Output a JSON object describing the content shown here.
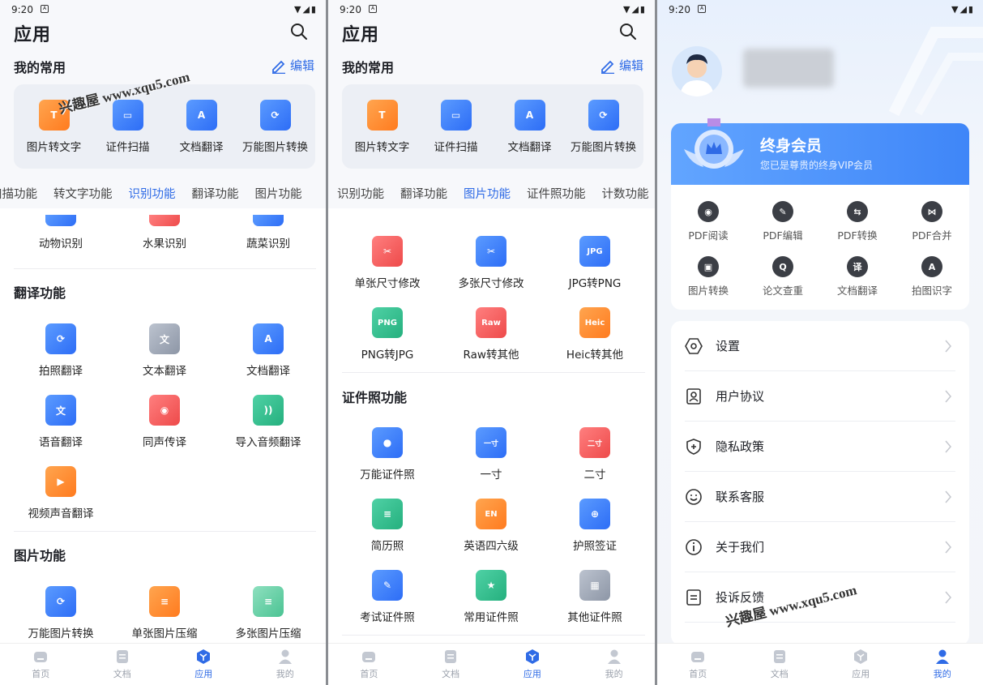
{
  "status": {
    "time": "9:20",
    "icons": "▼◢▮"
  },
  "page_title": "应用",
  "favorites": {
    "title": "我的常用",
    "edit_label": "编辑",
    "items": [
      {
        "label": "图片转文字",
        "icon": "image-to-text-icon",
        "glyph": "T"
      },
      {
        "label": "证件扫描",
        "icon": "id-scan-icon",
        "glyph": "▭"
      },
      {
        "label": "文档翻译",
        "icon": "doc-translate-icon",
        "glyph": "A"
      },
      {
        "label": "万能图片转换",
        "icon": "image-convert-icon",
        "glyph": "⟳"
      }
    ]
  },
  "panel1": {
    "tabs": [
      "扫描功能",
      "转文字功能",
      "识别功能",
      "翻译功能",
      "图片功能"
    ],
    "active_tab": 2,
    "recognize_items": [
      "动物识别",
      "水果识别",
      "蔬菜识别"
    ],
    "translate_title": "翻译功能",
    "translate_items": [
      {
        "label": "拍照翻译",
        "icon": "camera-translate-icon",
        "glyph": "⟳"
      },
      {
        "label": "文本翻译",
        "icon": "text-translate-icon",
        "glyph": "文"
      },
      {
        "label": "文档翻译",
        "icon": "doc-translate-icon",
        "glyph": "A"
      },
      {
        "label": "语音翻译",
        "icon": "voice-translate-icon",
        "glyph": "文"
      },
      {
        "label": "同声传译",
        "icon": "simultaneous-interp-icon",
        "glyph": "◉"
      },
      {
        "label": "导入音频翻译",
        "icon": "audio-import-translate-icon",
        "glyph": "))"
      },
      {
        "label": "视频声音翻译",
        "icon": "video-translate-icon",
        "glyph": "▶"
      }
    ],
    "image_title": "图片功能",
    "image_items": [
      {
        "label": "万能图片转换",
        "icon": "image-convert-icon",
        "glyph": "⟳"
      },
      {
        "label": "单张图片压缩",
        "icon": "image-compress-icon",
        "glyph": "≡"
      },
      {
        "label": "多张图片压缩",
        "icon": "multi-image-compress-icon",
        "glyph": "≡"
      }
    ]
  },
  "panel2": {
    "tabs": [
      "识别功能",
      "翻译功能",
      "图片功能",
      "证件照功能",
      "计数功能"
    ],
    "active_tab": 2,
    "image_items": [
      {
        "label": "单张尺寸修改",
        "icon": "resize-icon",
        "glyph": "✂"
      },
      {
        "label": "多张尺寸修改",
        "icon": "multi-resize-icon",
        "glyph": "✂"
      },
      {
        "label": "JPG转PNG",
        "icon": "jpg-to-png-icon",
        "glyph": "JPG"
      },
      {
        "label": "PNG转JPG",
        "icon": "png-to-jpg-icon",
        "glyph": "PNG"
      },
      {
        "label": "Raw转其他",
        "icon": "raw-convert-icon",
        "glyph": "Raw"
      },
      {
        "label": "Heic转其他",
        "icon": "heic-convert-icon",
        "glyph": "Heic"
      }
    ],
    "idphoto_title": "证件照功能",
    "idphoto_items": [
      {
        "label": "万能证件照",
        "icon": "universal-id-photo-icon",
        "glyph": "●"
      },
      {
        "label": "一寸",
        "icon": "one-inch-photo-icon",
        "glyph": "一寸"
      },
      {
        "label": "二寸",
        "icon": "two-inch-photo-icon",
        "glyph": "二寸"
      },
      {
        "label": "简历照",
        "icon": "resume-photo-icon",
        "glyph": "≡"
      },
      {
        "label": "英语四六级",
        "icon": "cet-photo-icon",
        "glyph": "EN"
      },
      {
        "label": "护照签证",
        "icon": "passport-photo-icon",
        "glyph": "⊕"
      },
      {
        "label": "考试证件照",
        "icon": "exam-photo-icon",
        "glyph": "✎"
      },
      {
        "label": "常用证件照",
        "icon": "common-photo-icon",
        "glyph": "★"
      },
      {
        "label": "其他证件照",
        "icon": "other-photo-icon",
        "glyph": "▦"
      }
    ]
  },
  "panel3": {
    "vip_title": "终身会员",
    "vip_subtitle": "您已是尊贵的终身VIP会员",
    "vip_items": [
      {
        "label": "PDF阅读",
        "icon": "eye-icon",
        "glyph": "◉"
      },
      {
        "label": "PDF编辑",
        "icon": "edit-icon",
        "glyph": "✎"
      },
      {
        "label": "PDF转换",
        "icon": "swap-icon",
        "glyph": "⇆"
      },
      {
        "label": "PDF合并",
        "icon": "merge-icon",
        "glyph": "⋈"
      },
      {
        "label": "图片转换",
        "icon": "image-icon",
        "glyph": "▣"
      },
      {
        "label": "论文查重",
        "icon": "magnifier-icon",
        "glyph": "Q"
      },
      {
        "label": "文档翻译",
        "icon": "translate-icon",
        "glyph": "译"
      },
      {
        "label": "拍图识字",
        "icon": "scan-text-icon",
        "glyph": "A"
      }
    ],
    "menu": [
      {
        "label": "设置",
        "icon": "settings-icon"
      },
      {
        "label": "用户协议",
        "icon": "user-agreement-icon"
      },
      {
        "label": "隐私政策",
        "icon": "privacy-icon"
      },
      {
        "label": "联系客服",
        "icon": "smile-icon"
      },
      {
        "label": "关于我们",
        "icon": "info-icon"
      },
      {
        "label": "投诉反馈",
        "icon": "feedback-icon"
      }
    ]
  },
  "tabbar": [
    {
      "label": "首页",
      "icon": "home-icon"
    },
    {
      "label": "文档",
      "icon": "document-icon"
    },
    {
      "label": "应用",
      "icon": "apps-icon"
    },
    {
      "label": "我的",
      "icon": "profile-icon"
    }
  ],
  "watermark": "兴趣屋 www.xqu5.com",
  "colors": {
    "accent": "#2f6be6",
    "vip": "#4a8ef8"
  }
}
